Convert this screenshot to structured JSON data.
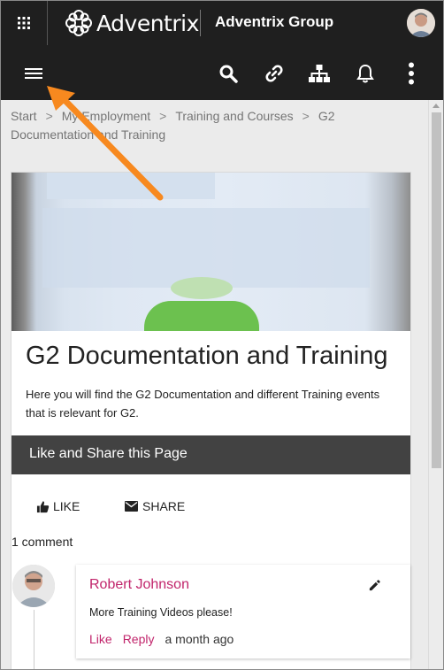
{
  "header": {
    "brand": "Adventrix",
    "group_title": "Adventrix Group"
  },
  "icons": {
    "apps": "apps-grid-icon",
    "menu": "hamburger-menu-icon",
    "search": "search-icon",
    "link": "link-icon",
    "sitemap": "sitemap-icon",
    "notifications": "bell-icon",
    "more": "more-vertical-icon",
    "edit": "pencil-icon",
    "like": "thumbs-up-icon",
    "share": "envelope-icon"
  },
  "breadcrumb": {
    "items": [
      "Start",
      "My Employment",
      "Training and Courses",
      "G2"
    ],
    "continuation": "Documentation and Training",
    "separator": ">"
  },
  "page": {
    "title": "G2 Documentation and Training",
    "description": "Here you will find the G2 Documentation and different Training events that is relevant for G2."
  },
  "share_bar": {
    "label": "Like and Share this Page"
  },
  "actions": {
    "like_label": "LIKE",
    "share_label": "SHARE"
  },
  "comments": {
    "count_label": "1 comment",
    "items": [
      {
        "author": "Robert Johnson",
        "text": "More Training Videos please!",
        "like_label": "Like",
        "reply_label": "Reply",
        "time": "a month ago"
      }
    ]
  },
  "colors": {
    "header_bg": "#1f1f1f",
    "accent": "#c1246b",
    "annotation_arrow": "#f7891f",
    "share_bar_bg": "#424242"
  }
}
